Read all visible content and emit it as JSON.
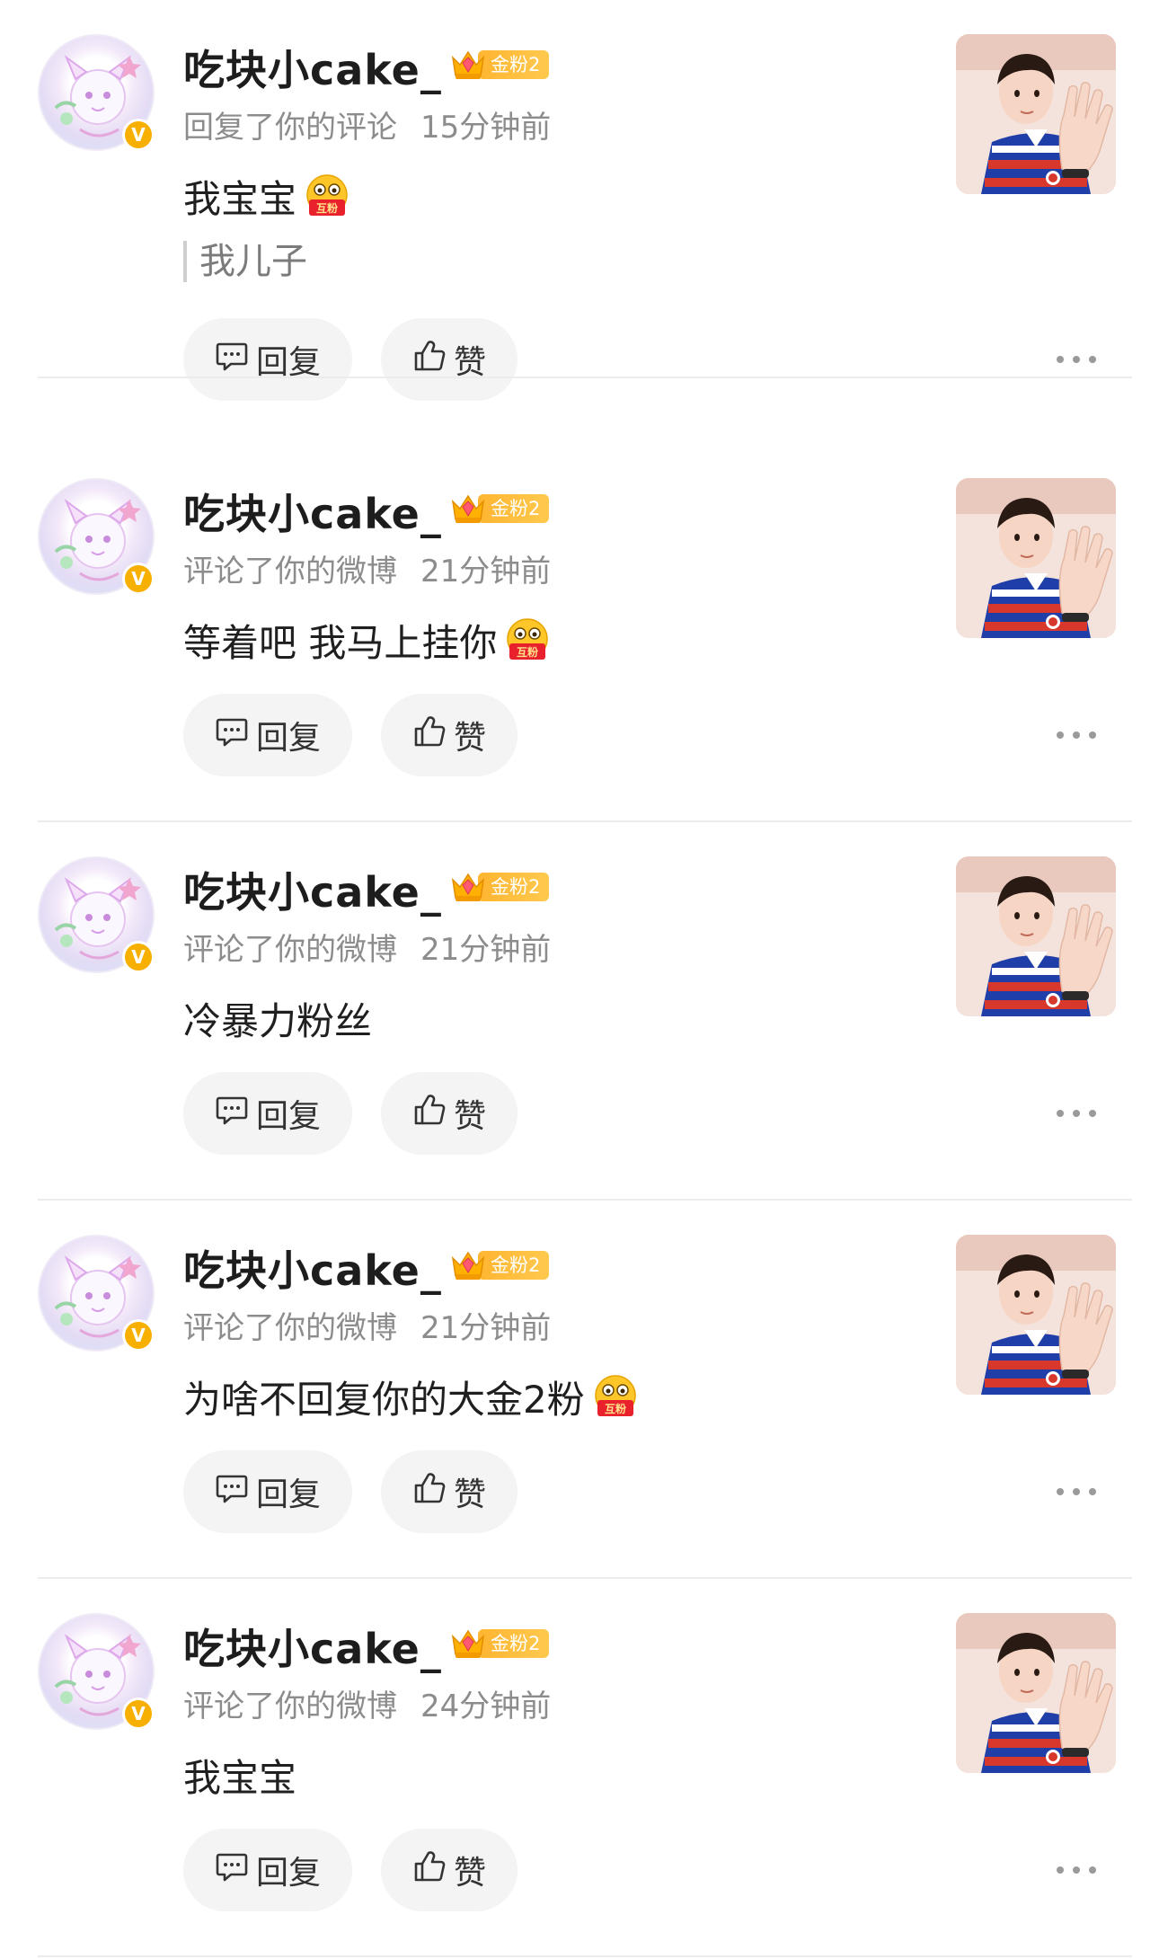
{
  "user": {
    "name": "吃块小cake_",
    "fan_badge": "金粉2",
    "verified_mark": "V"
  },
  "emoji_label": "互粉",
  "actions": {
    "reply": "回复",
    "like": "赞"
  },
  "icons": {
    "reply": "comment-icon",
    "like": "thumbs-up-icon",
    "more": "more-dots-icon",
    "crown": "crown-icon",
    "emoji": "hufen-emoji-icon"
  },
  "colors": {
    "verified": "#f7b000",
    "fan_badge": "#ffbb38",
    "divider": "#ececec"
  },
  "notifications": [
    {
      "action": "回复了你的评论",
      "time": "15分钟前",
      "text": "我宝宝",
      "has_emoji": true,
      "quote": "我儿子"
    },
    {
      "action": "评论了你的微博",
      "time": "21分钟前",
      "text": "等着吧 我马上挂你",
      "has_emoji": true,
      "quote": ""
    },
    {
      "action": "评论了你的微博",
      "time": "21分钟前",
      "text": "冷暴力粉丝",
      "has_emoji": false,
      "quote": ""
    },
    {
      "action": "评论了你的微博",
      "time": "21分钟前",
      "text": "为啥不回复你的大金2粉",
      "has_emoji": true,
      "quote": ""
    },
    {
      "action": "评论了你的微博",
      "time": "24分钟前",
      "text": "我宝宝",
      "has_emoji": false,
      "quote": ""
    }
  ]
}
